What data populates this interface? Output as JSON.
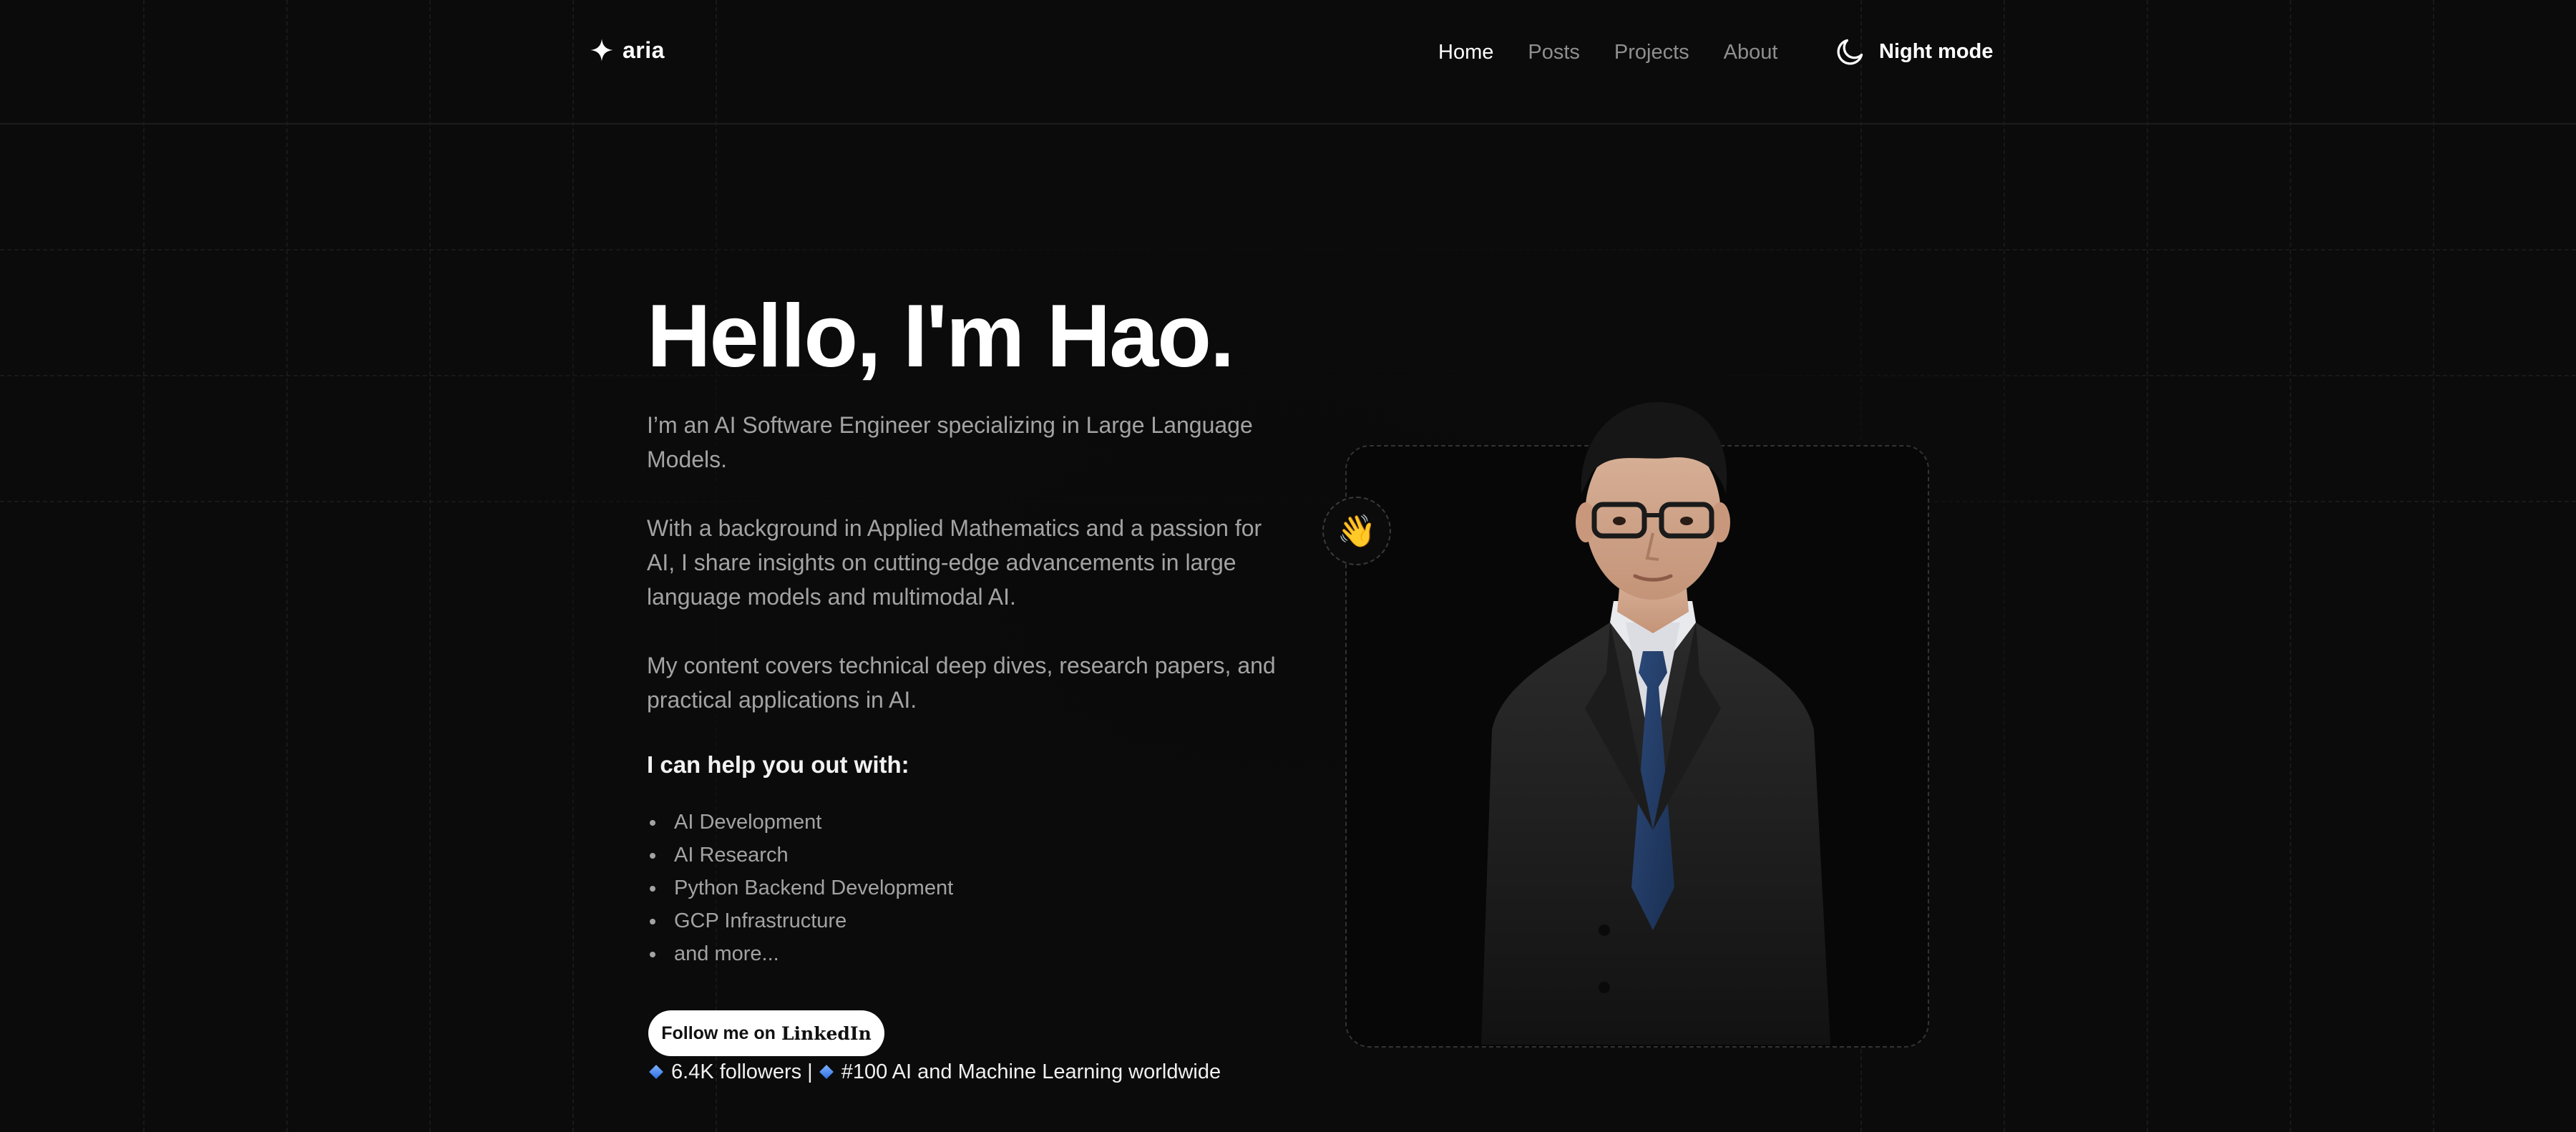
{
  "brand": {
    "name": "aria",
    "icon": "sparkle-icon"
  },
  "nav": {
    "items": [
      {
        "label": "Home",
        "active": true
      },
      {
        "label": "Posts",
        "active": false
      },
      {
        "label": "Projects",
        "active": false
      },
      {
        "label": "About",
        "active": false
      }
    ],
    "night_mode": {
      "label": "Night mode",
      "icon": "moon-icon"
    }
  },
  "hero": {
    "title": "Hello, I'm Hao.",
    "paragraphs": [
      "I’m an AI Software Engineer specializing in Large Language Models.",
      "With a background in Applied Mathematics and a passion for AI, I share insights on cutting-edge advancements in large language models and multimodal AI.",
      "My content covers technical deep dives, research papers, and practical applications in AI."
    ],
    "help_title": "I can help you out with:",
    "help_items": [
      "AI Development",
      "AI Research",
      "Python Backend Development",
      "GCP Infrastructure",
      "and more..."
    ],
    "cta": {
      "label": "Follow me on",
      "brand": "LinkedIn"
    },
    "stats": {
      "followers": "6.4K followers",
      "separator": "|",
      "rank": "#100 AI and Machine Learning worldwide"
    }
  },
  "portrait": {
    "wave_emoji": "👋",
    "icon": "waving-hand-icon"
  },
  "colors": {
    "background": "#0b0b0b",
    "text": "#ffffff",
    "muted_text": "#a3a3a3",
    "nav_inactive": "#8f8f8f",
    "button_bg": "#ffffff",
    "accent_blue": "#3b82f6"
  }
}
